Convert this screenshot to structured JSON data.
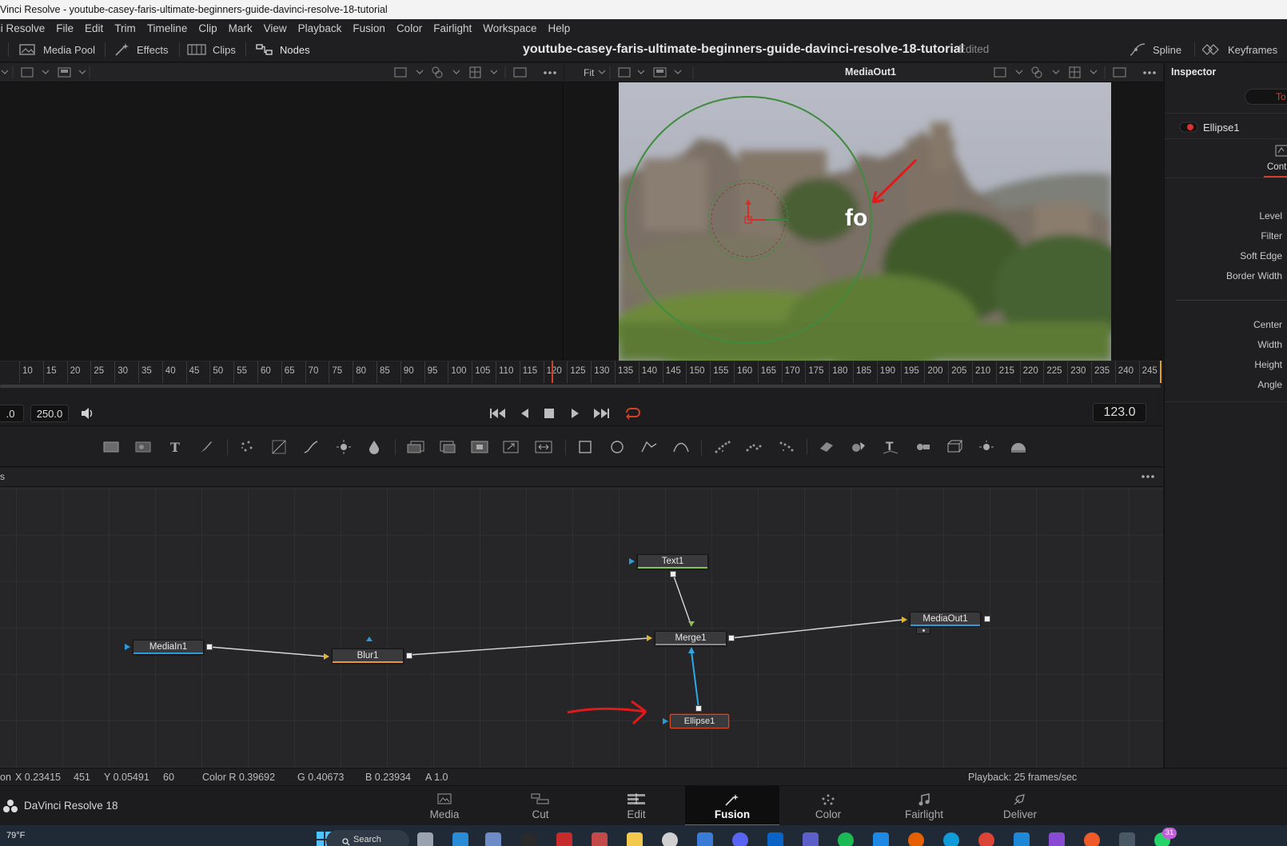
{
  "window": {
    "title": "Vinci Resolve - youtube-casey-faris-ultimate-beginners-guide-davinci-resolve-18-tutorial"
  },
  "menu": [
    "ci Resolve",
    "File",
    "Edit",
    "Trim",
    "Timeline",
    "Clip",
    "Mark",
    "View",
    "Playback",
    "Fusion",
    "Color",
    "Fairlight",
    "Workspace",
    "Help"
  ],
  "toolbar": {
    "media_pool": "Media Pool",
    "effects": "Effects",
    "clips": "Clips",
    "nodes": "Nodes",
    "project_title": "youtube-casey-faris-ultimate-beginners-guide-davinci-resolve-18-tutorial",
    "project_status": "Edited",
    "spline": "Spline",
    "keyframes": "Keyframes"
  },
  "viewer": {
    "fit_label": "Fit",
    "right_title": "MediaOut1",
    "overlay_text": "fo"
  },
  "ruler": {
    "ticks": [
      "10",
      "15",
      "20",
      "25",
      "30",
      "35",
      "40",
      "45",
      "50",
      "55",
      "60",
      "65",
      "70",
      "75",
      "80",
      "85",
      "90",
      "95",
      "100",
      "105",
      "110",
      "115",
      "120",
      "125",
      "130",
      "135",
      "140",
      "145",
      "150",
      "155",
      "160",
      "165",
      "170",
      "175",
      "180",
      "185",
      "190",
      "195",
      "200",
      "205",
      "210",
      "215",
      "220",
      "225",
      "230",
      "235",
      "240",
      "245"
    ],
    "playhead_frame": 123
  },
  "transport": {
    "start_value": ".0",
    "end_value": "250.0",
    "current_frame": "123.0"
  },
  "nodes_panel": {
    "label": "s",
    "nodes": {
      "text": "Text1",
      "mediain": "MediaIn1",
      "blur": "Blur1",
      "merge": "Merge1",
      "mediaout": "MediaOut1",
      "ellipse": "Ellipse1"
    }
  },
  "inspector": {
    "title": "Inspector",
    "tab_partial": "To",
    "tool_name": "Ellipse1",
    "subtab": "Contr",
    "params_top": [
      "Level",
      "Filter",
      "Soft Edge",
      "Border Width"
    ],
    "params_bottom": [
      "Center",
      "Width",
      "Height",
      "Angle"
    ]
  },
  "status": {
    "pos_label": "on",
    "x": "X 0.23415",
    "x_px": "451",
    "y": "Y 0.05491",
    "y_px": "60",
    "color_r": "Color R 0.39692",
    "color_g": "G 0.40673",
    "color_b": "B 0.23934",
    "color_a": "A 1.0",
    "playback": "Playback: 25 frames/sec"
  },
  "pages": {
    "app_name": "DaVinci Resolve 18",
    "tabs": [
      "Media",
      "Cut",
      "Edit",
      "Fusion",
      "Color",
      "Fairlight",
      "Deliver"
    ],
    "active": "Fusion"
  },
  "taskbar": {
    "weather": "79°F",
    "search": "Search",
    "badge": "31"
  },
  "colors": {
    "accent": "#d2402a",
    "node_text_bar": "#8bc34a",
    "node_media_bar": "#2d9bd9",
    "node_blur_bar": "#e59a3a",
    "mask_link": "#2ea8e6"
  }
}
